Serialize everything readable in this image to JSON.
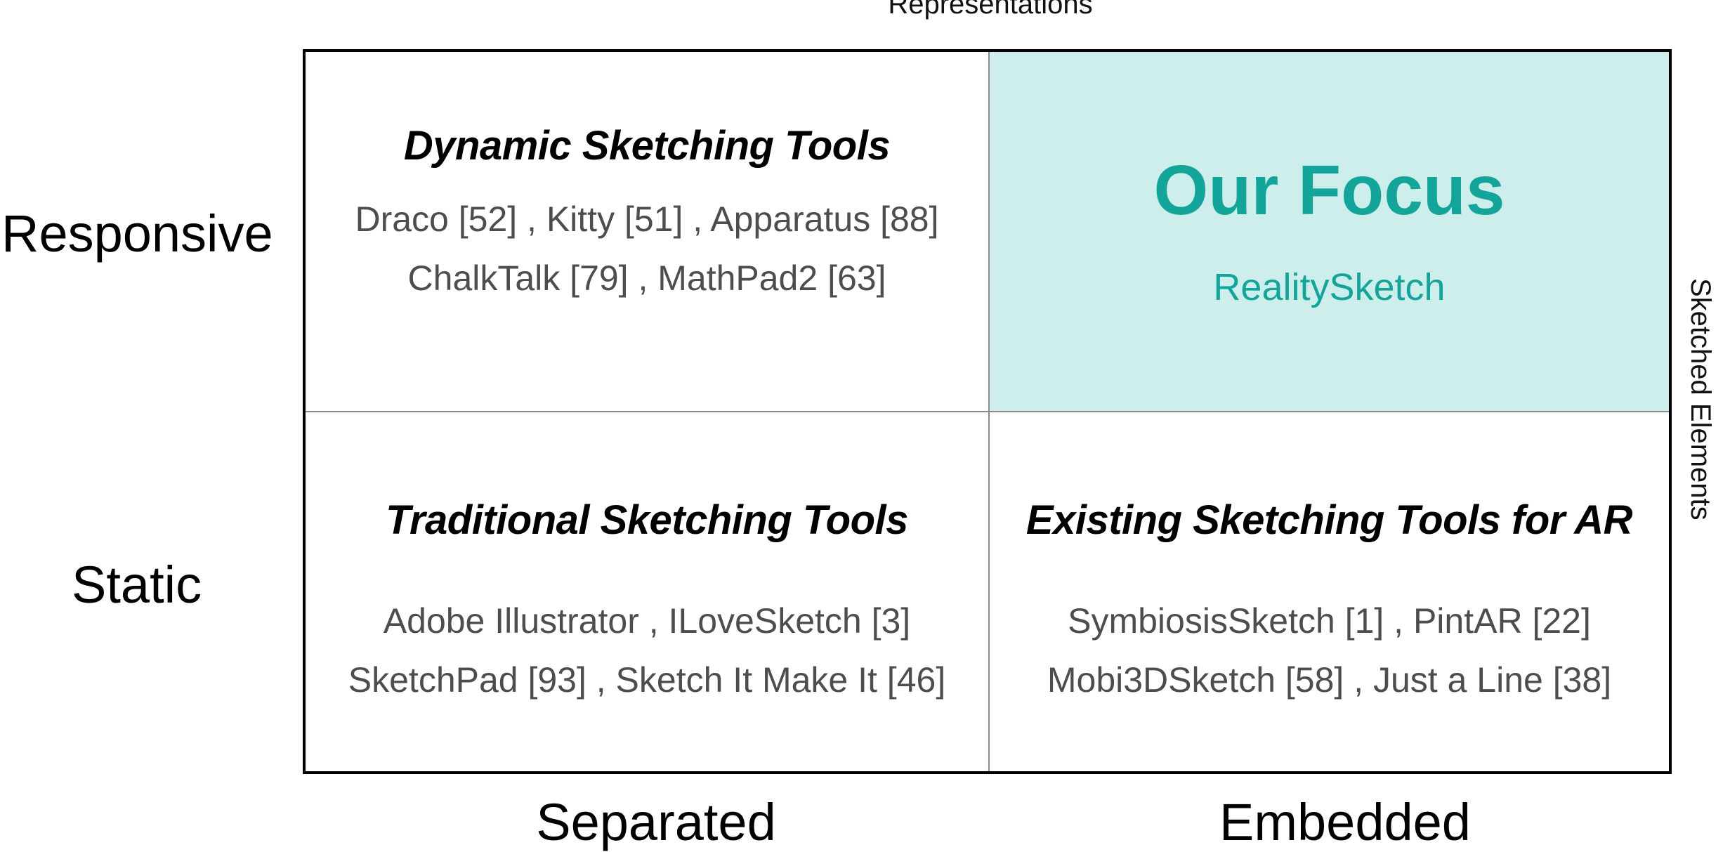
{
  "axes": {
    "top": "Representations",
    "right": "Sketched Elements",
    "rows": [
      "Responsive",
      "Static"
    ],
    "columns": [
      "Separated",
      "Embedded"
    ]
  },
  "quadrants": {
    "top_left": {
      "title": "Dynamic Sketching Tools",
      "lines": [
        "Draco [52] , Kitty [51] , Apparatus [88]",
        "ChalkTalk [79] , MathPad2 [63]"
      ]
    },
    "top_right": {
      "title": "Our Focus",
      "subtitle": "RealitySketch",
      "highlight_color": "#cdeeeb",
      "text_color": "#12a69a"
    },
    "bottom_left": {
      "title": "Traditional Sketching Tools",
      "lines": [
        "Adobe Illustrator , ILoveSketch [3]",
        "SketchPad [93] , Sketch It Make It [46]"
      ]
    },
    "bottom_right": {
      "title": "Existing Sketching Tools for AR",
      "lines": [
        "SymbiosisSketch [1] , PintAR [22]",
        "Mobi3DSketch [58] , Just a Line [38]"
      ]
    }
  }
}
